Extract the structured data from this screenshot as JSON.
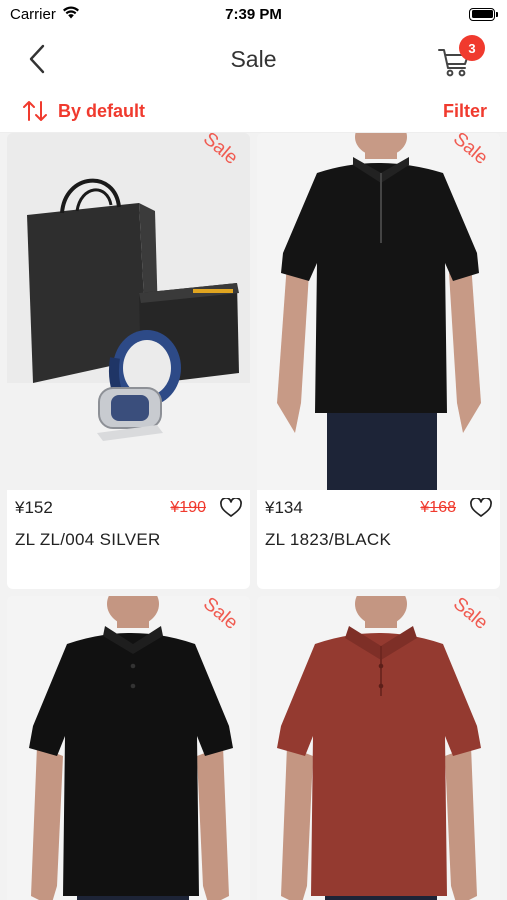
{
  "status_bar": {
    "carrier": "Carrier",
    "time": "7:39 PM"
  },
  "nav": {
    "title": "Sale",
    "cart_count": "3"
  },
  "sort": {
    "label": "By default",
    "filter_label": "Filter"
  },
  "colors": {
    "accent": "#f03a2e"
  },
  "products": [
    {
      "sale_label": "Sale",
      "price": "¥152",
      "old_price": "¥190",
      "name": "ZL ZL/004 SILVER",
      "image": "gift-bag-and-belt"
    },
    {
      "sale_label": "Sale",
      "price": "¥134",
      "old_price": "¥168",
      "name": "ZL 1823/BLACK",
      "image": "black-zip-polo"
    },
    {
      "sale_label": "Sale",
      "image": "black-polo"
    },
    {
      "sale_label": "Sale",
      "image": "red-polo"
    }
  ]
}
